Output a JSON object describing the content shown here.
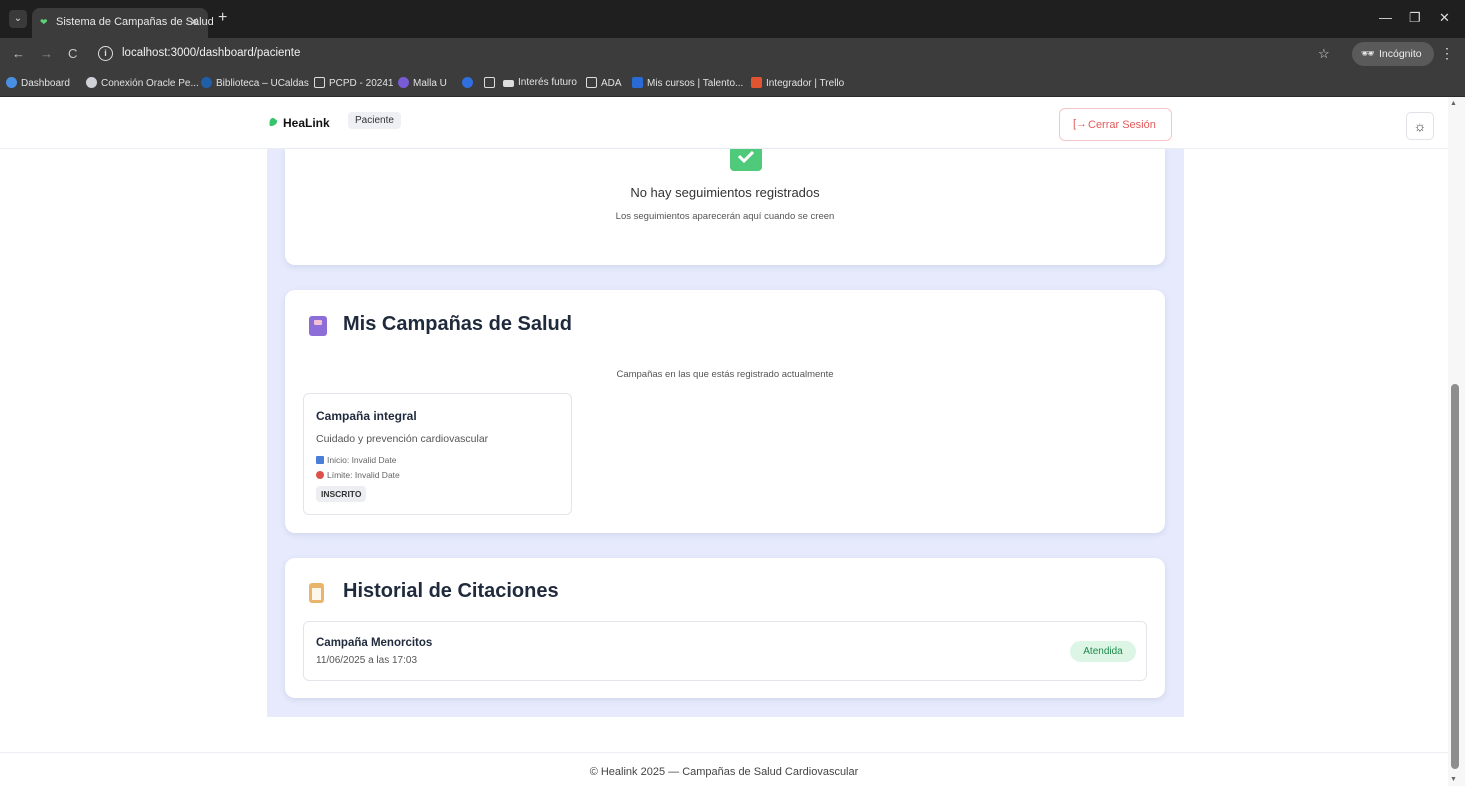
{
  "browser": {
    "tab_title": "Sistema de Campañas de Salud",
    "new_tab": "+",
    "url": "localhost:3000/dashboard/paciente",
    "profile_label": "Incógnito",
    "window_controls": {
      "minimize": "—",
      "maximize": "❐",
      "close": "✕"
    },
    "bookmarks": [
      {
        "label": "Dashboard",
        "icon_color": "#4a90e2"
      },
      {
        "label": "Conexión Oracle Pe...",
        "icon_color": "#cfd3d8"
      },
      {
        "label": "Biblioteca – UCaldas",
        "icon_color": "#1f5fa8"
      },
      {
        "label": "PCPD - 20241",
        "icon_color": "folder"
      },
      {
        "label": "Malla U",
        "icon_color": "#7a5bd6"
      },
      {
        "label": "",
        "icon_color": "#2f6fe0"
      },
      {
        "label": "",
        "icon_color": "folder"
      },
      {
        "label": "Interés futuro",
        "icon_color": "folder"
      },
      {
        "label": "ADA",
        "icon_color": "folder"
      },
      {
        "label": "Mis cursos | Talento...",
        "icon_color": "#2a6ad6"
      },
      {
        "label": "Integrador | Trello",
        "icon_color": "#e0552f"
      }
    ]
  },
  "header": {
    "brand": "HeaLink",
    "role_badge": "Paciente",
    "logout_label": "Cerrar Sesión",
    "theme_icon": "sun-icon",
    "colors": {
      "brand_green": "#35c46a",
      "logout_red": "#e25a5a"
    }
  },
  "seguimientos": {
    "empty_title": "No hay seguimientos registrados",
    "empty_subtitle": "Los seguimientos aparecerán aquí cuando se creen"
  },
  "campanas": {
    "title": "Mis Campañas de Salud",
    "subtitle": "Campañas en las que estás registrado actualmente",
    "items": [
      {
        "name": "Campaña integral",
        "description": "Cuidado y prevención cardiovascular",
        "start_label": "Inicio: Invalid Date",
        "end_label": "Límite: Invalid Date",
        "status": "INSCRITO"
      }
    ]
  },
  "historial": {
    "title": "Historial de Citaciones",
    "items": [
      {
        "name": "Campaña Menorcitos",
        "date": "11/06/2025 a las 17:03",
        "status": "Atendida"
      }
    ]
  },
  "footer": {
    "text": "© Healink 2025 — Campañas de Salud Cardiovascular"
  }
}
